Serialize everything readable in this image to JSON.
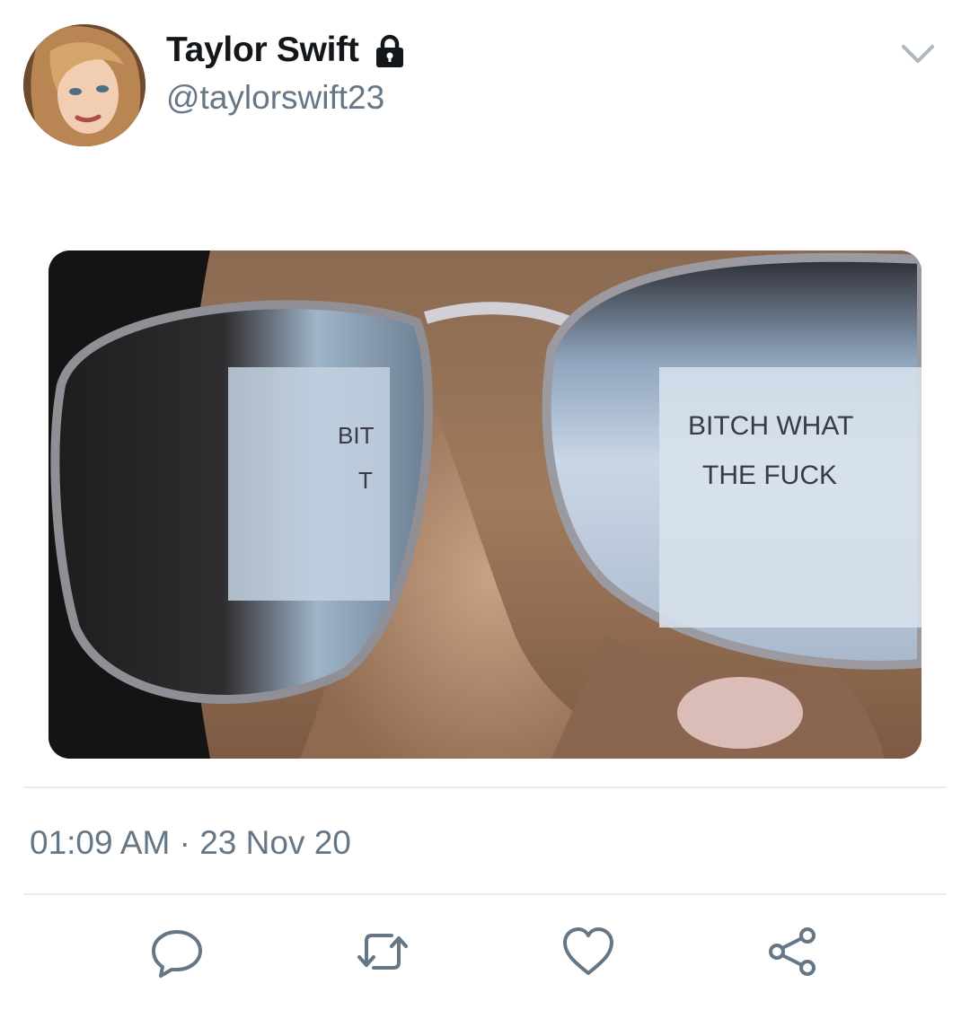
{
  "tweet": {
    "author_name": "Taylor Swift",
    "author_handle": "@taylorswift23",
    "protected_icon": "lock-icon",
    "menu_icon": "chevron-down-icon",
    "timestamp": "01:09 AM · 23 Nov 20",
    "media": {
      "left_lens_text": [
        "BIT",
        "T"
      ],
      "right_lens_text": [
        "BITCH WHAT",
        "THE FUCK"
      ]
    },
    "actions": [
      {
        "name": "reply",
        "icon": "reply-icon"
      },
      {
        "name": "retweet",
        "icon": "retweet-icon"
      },
      {
        "name": "like",
        "icon": "heart-icon"
      },
      {
        "name": "share",
        "icon": "share-icon"
      }
    ]
  },
  "colors": {
    "text_primary": "#14171a",
    "text_secondary": "#657786",
    "divider": "#e6ecf0"
  }
}
